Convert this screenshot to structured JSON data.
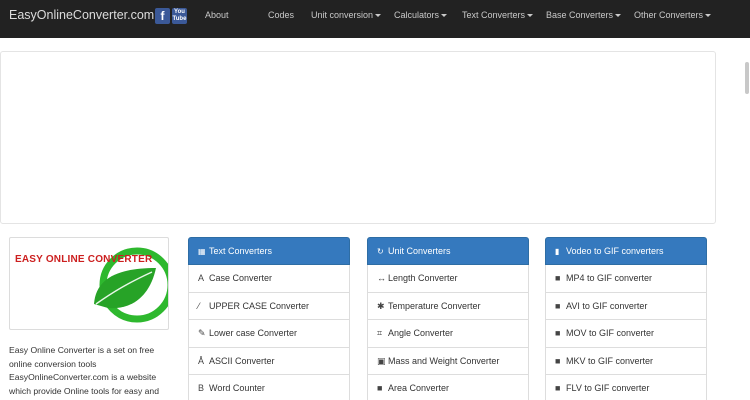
{
  "navbar": {
    "brand": "EasyOnlineConverter.com",
    "social": {
      "facebook": "f",
      "youtube": "You Tube"
    },
    "items": [
      {
        "label": "About",
        "dropdown": false
      },
      {
        "label": "Codes",
        "dropdown": false
      },
      {
        "label": "Unit conversion",
        "dropdown": true
      },
      {
        "label": "Calculators",
        "dropdown": true
      },
      {
        "label": "Text Converters",
        "dropdown": true
      },
      {
        "label": "Base Converters",
        "dropdown": true
      },
      {
        "label": "Other Converters",
        "dropdown": true
      }
    ]
  },
  "logo": {
    "text": "EASY ONLINE CONVERTER"
  },
  "about": {
    "text": "Easy Online Converter is a set on free online conversion tools EasyOnlineConverter.com is a website which provide Online tools for easy and"
  },
  "panels": [
    {
      "title": "Text Converters",
      "icon": "file-text-icon",
      "items": [
        {
          "label": "Case Converter",
          "icon": "font-icon"
        },
        {
          "label": "UPPER CASE Converter",
          "icon": "wand-icon"
        },
        {
          "label": "Lower case Converter",
          "icon": "pen-icon"
        },
        {
          "label": "ASCII Converter",
          "icon": "text-icon"
        },
        {
          "label": "Word Counter",
          "icon": "bold-icon"
        }
      ]
    },
    {
      "title": "Unit Converters",
      "icon": "refresh-icon",
      "items": [
        {
          "label": "Length Converter",
          "icon": "resize-horizontal-icon"
        },
        {
          "label": "Temperature Converter",
          "icon": "asterisk-icon"
        },
        {
          "label": "Angle Converter",
          "icon": "crop-icon"
        },
        {
          "label": "Mass and Weight Converter",
          "icon": "scale-icon"
        },
        {
          "label": "Area Converter",
          "icon": "stop-icon"
        }
      ]
    },
    {
      "title": "Vodeo to GIF converters",
      "icon": "phone-icon",
      "items": [
        {
          "label": "MP4 to GIF converter",
          "icon": "video-camera-icon"
        },
        {
          "label": "AVI to GIF converter",
          "icon": "video-camera-icon"
        },
        {
          "label": "MOV to GIF converter",
          "icon": "video-camera-icon"
        },
        {
          "label": "MKV to GIF converter",
          "icon": "video-camera-icon"
        },
        {
          "label": "FLV to GIF converter",
          "icon": "video-camera-icon"
        }
      ]
    }
  ]
}
